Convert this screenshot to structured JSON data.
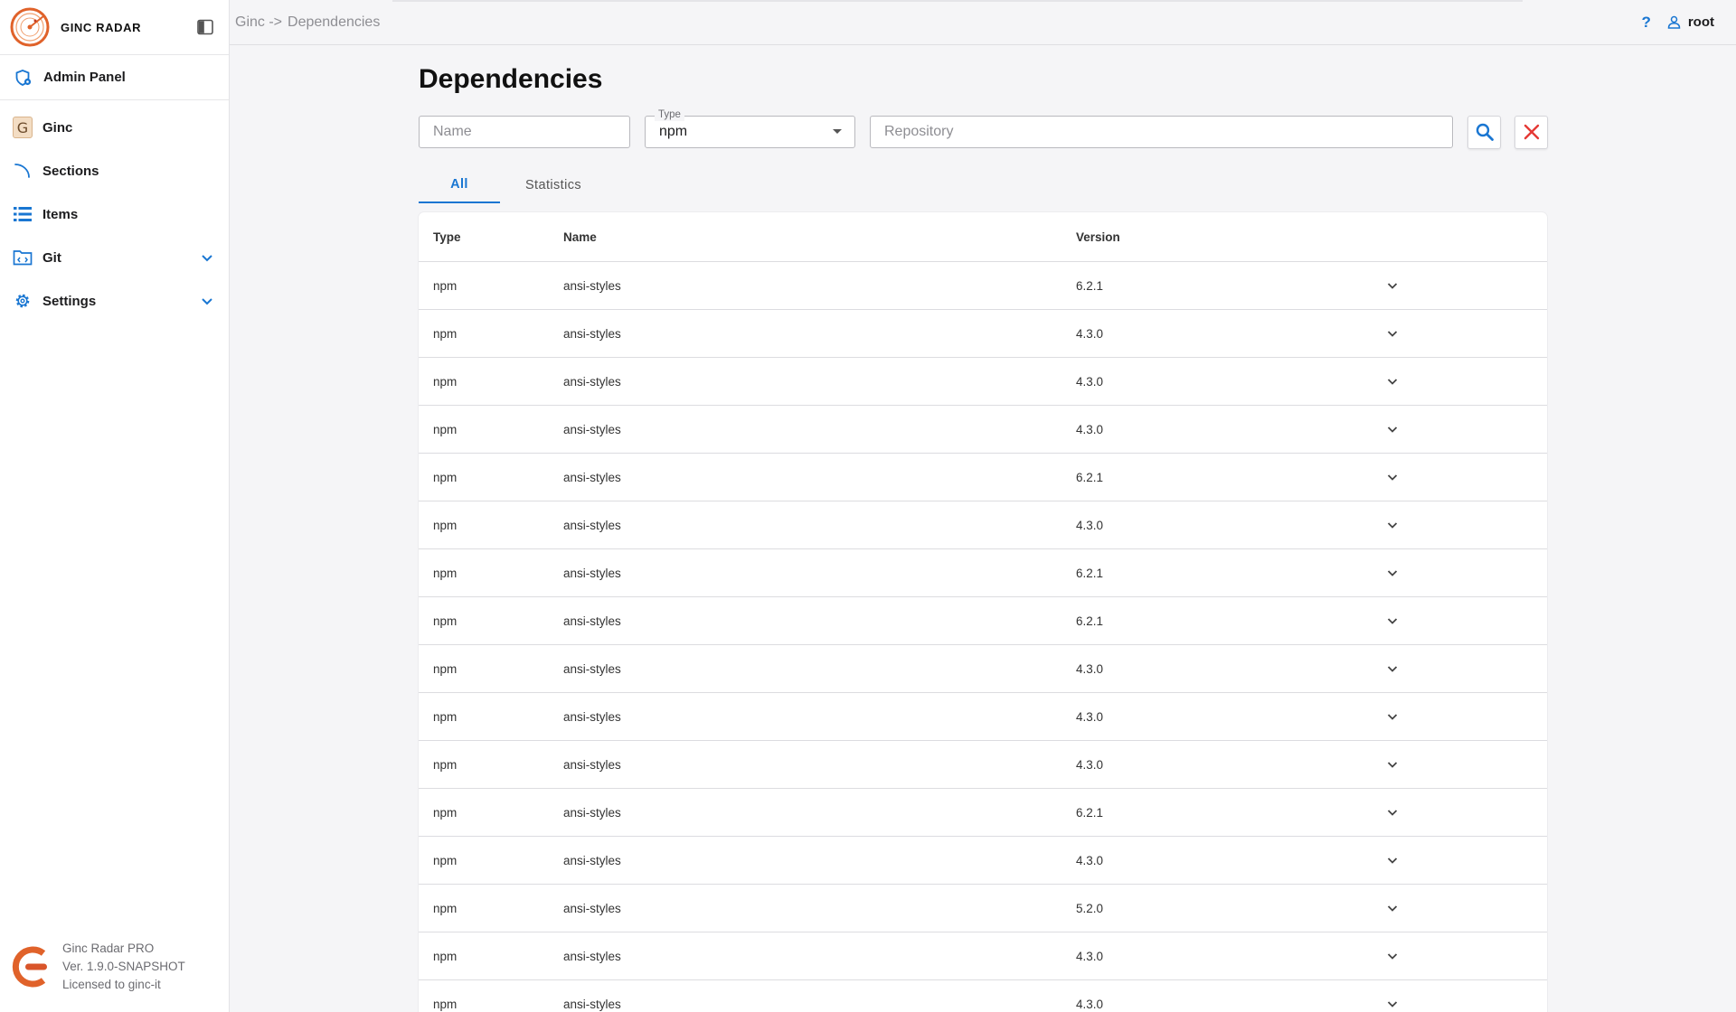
{
  "brand": {
    "name": "GINC RADAR"
  },
  "sidebar": {
    "admin": {
      "label": "Admin Panel"
    },
    "items": [
      {
        "label": "Ginc",
        "icon": "g-badge-icon",
        "badge": "G"
      },
      {
        "label": "Sections",
        "icon": "arc-icon"
      },
      {
        "label": "Items",
        "icon": "list-icon"
      },
      {
        "label": "Git",
        "icon": "git-folder-icon",
        "expandable": true
      },
      {
        "label": "Settings",
        "icon": "gear-icon",
        "expandable": true
      }
    ],
    "footer": {
      "line1": "Ginc Radar PRO",
      "line2": "Ver. 1.9.0-SNAPSHOT",
      "line3": "Licensed to ginc-it"
    }
  },
  "topbar": {
    "breadcrumb": [
      "Ginc ->",
      "Dependencies"
    ],
    "help": "?",
    "user": "root"
  },
  "page": {
    "title": "Dependencies",
    "filters": {
      "name_placeholder": "Name",
      "type_label": "Type",
      "type_value": "npm",
      "repo_placeholder": "Repository"
    },
    "tabs": [
      "All",
      "Statistics"
    ],
    "active_tab": "All"
  },
  "table": {
    "headers": {
      "type": "Type",
      "name": "Name",
      "version": "Version"
    },
    "rows": [
      {
        "type": "npm",
        "name": "ansi-styles",
        "version": "6.2.1"
      },
      {
        "type": "npm",
        "name": "ansi-styles",
        "version": "4.3.0"
      },
      {
        "type": "npm",
        "name": "ansi-styles",
        "version": "4.3.0"
      },
      {
        "type": "npm",
        "name": "ansi-styles",
        "version": "4.3.0"
      },
      {
        "type": "npm",
        "name": "ansi-styles",
        "version": "6.2.1"
      },
      {
        "type": "npm",
        "name": "ansi-styles",
        "version": "4.3.0"
      },
      {
        "type": "npm",
        "name": "ansi-styles",
        "version": "6.2.1"
      },
      {
        "type": "npm",
        "name": "ansi-styles",
        "version": "6.2.1"
      },
      {
        "type": "npm",
        "name": "ansi-styles",
        "version": "4.3.0"
      },
      {
        "type": "npm",
        "name": "ansi-styles",
        "version": "4.3.0"
      },
      {
        "type": "npm",
        "name": "ansi-styles",
        "version": "4.3.0"
      },
      {
        "type": "npm",
        "name": "ansi-styles",
        "version": "6.2.1"
      },
      {
        "type": "npm",
        "name": "ansi-styles",
        "version": "4.3.0"
      },
      {
        "type": "npm",
        "name": "ansi-styles",
        "version": "5.2.0"
      },
      {
        "type": "npm",
        "name": "ansi-styles",
        "version": "4.3.0"
      },
      {
        "type": "npm",
        "name": "ansi-styles",
        "version": "4.3.0"
      }
    ]
  },
  "colors": {
    "accent": "#1976d2",
    "danger": "#e53935",
    "brand_orange": "#e0622a"
  }
}
